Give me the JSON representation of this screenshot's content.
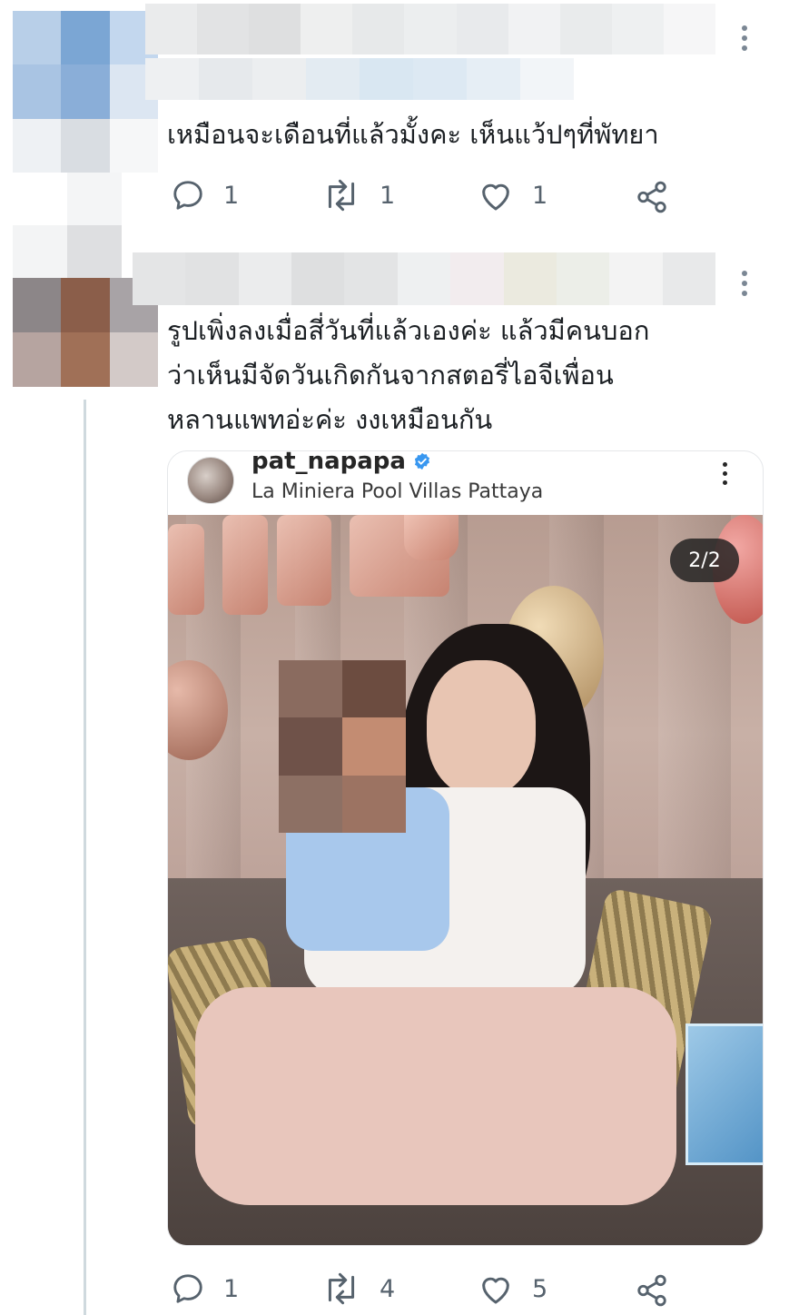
{
  "reply1": {
    "text": "เหมือนจะเดือนที่แล้วมั้งคะ เห็นแว้ปๆที่พัทยา",
    "actions": {
      "replies": "1",
      "retweets": "1",
      "likes": "1"
    }
  },
  "reply2": {
    "text_lines": [
      "รูปเพิ่งลงเมื่อสี่วันที่แล้วเองค่ะ แล้วมีคนบอก",
      "ว่าเห็นมีจัดวันเกิดกันจากสตอรี่ไอจีเพื่อน",
      "หลานแพทอ่ะค่ะ งงเหมือนกัน"
    ],
    "actions": {
      "replies": "1",
      "retweets": "4",
      "likes": "5"
    }
  },
  "embedded_post": {
    "username": "pat_napapa",
    "location": "La Miniera Pool Villas Pattaya",
    "page_indicator": "2/2"
  },
  "colors": {
    "text": "#1b1f23",
    "muted": "#56626d",
    "thread_line": "#cfd9de",
    "verified": "#3897f0"
  }
}
